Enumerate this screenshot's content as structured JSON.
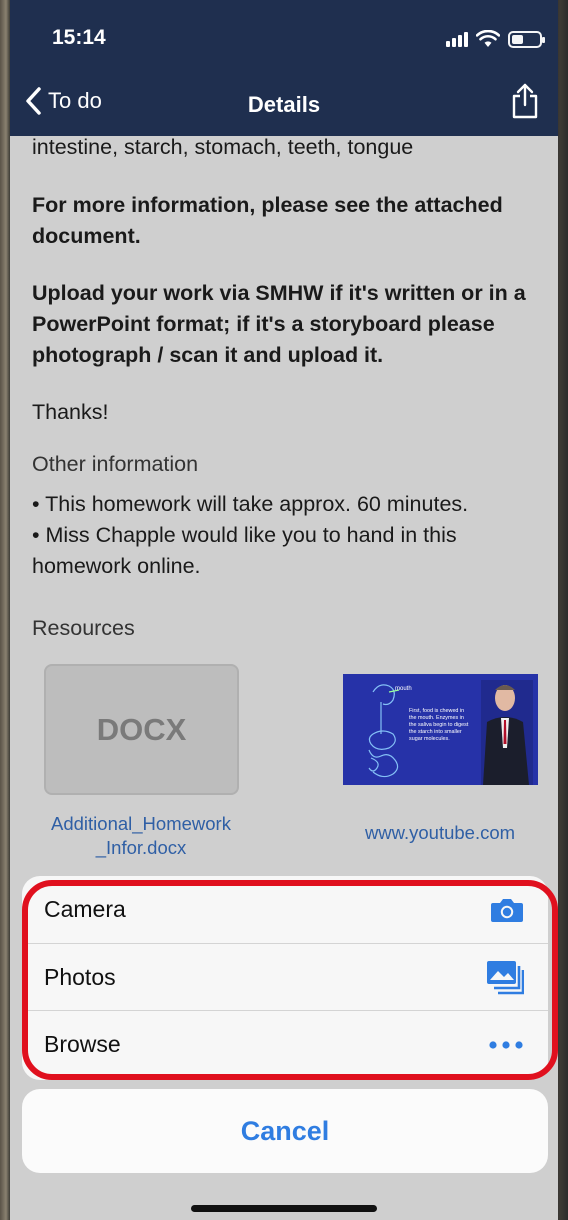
{
  "status_bar": {
    "time": "15:14"
  },
  "nav": {
    "back_label": "To do",
    "title": "Details"
  },
  "body": {
    "partial_line": "intestine, starch, stomach, teeth, tongue",
    "more_info": "For more information, please see the attached document.",
    "upload_instructions": "Upload your work via SMHW if it's written or in a PowerPoint format; if it's a storyboard please photograph / scan it and upload it.",
    "thanks": "Thanks!",
    "other_info_title": "Other information",
    "other_info_line1": "• This homework will take approx. 60 minutes.",
    "other_info_line2": "• Miss Chapple would like you to hand in this homework online.",
    "resources_title": "Resources"
  },
  "resources": [
    {
      "thumb_label": "DOCX",
      "link": "Additional_Homework _Infor.docx"
    },
    {
      "thumb_label": "",
      "link": "www.youtube.com",
      "video_text": "First, food is chewed in the mouth. Enzymes in the saliva begin to digest the starch into smaller sugar molecules.",
      "video_callout": "mouth"
    }
  ],
  "action_sheet": {
    "options": [
      {
        "label": "Camera",
        "icon": "camera-icon"
      },
      {
        "label": "Photos",
        "icon": "photos-icon"
      },
      {
        "label": "Browse",
        "icon": "more-icon"
      }
    ],
    "cancel_label": "Cancel"
  },
  "colors": {
    "nav_bg": "#1f2f4f",
    "link": "#2f5fa5",
    "accent": "#2f7de1",
    "highlight": "#e0101e"
  }
}
